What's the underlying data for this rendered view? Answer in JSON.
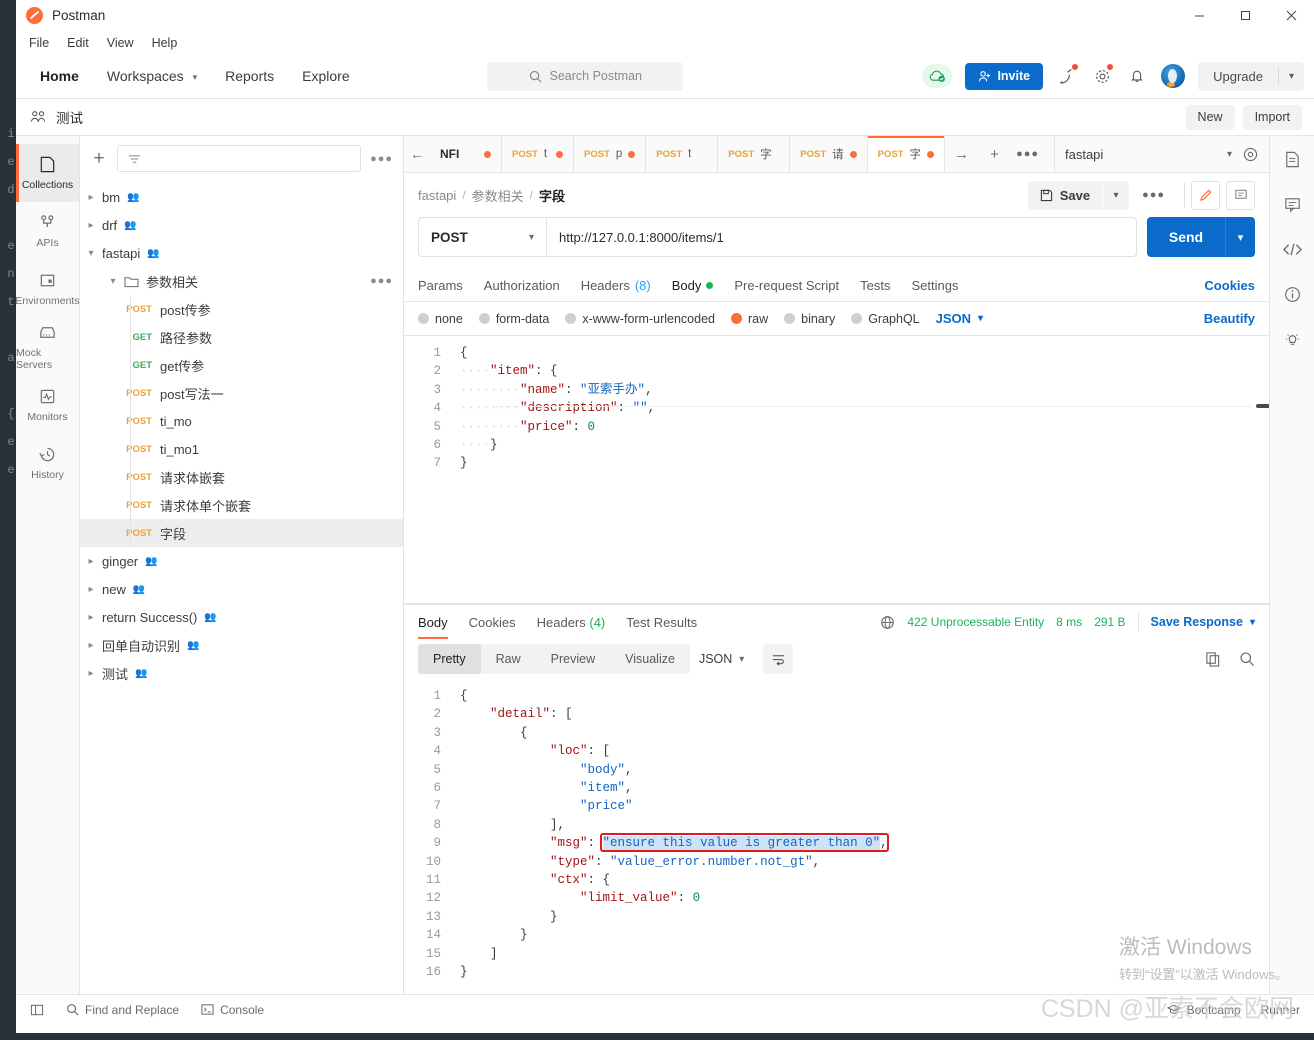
{
  "window": {
    "title": "Postman",
    "minimize": "─",
    "maximize": "☐",
    "close": "✕"
  },
  "menubar": {
    "items": [
      "File",
      "Edit",
      "View",
      "Help"
    ]
  },
  "header": {
    "nav": [
      "Home",
      "Workspaces",
      "Reports",
      "Explore"
    ],
    "search_placeholder": "Search Postman",
    "invite_label": "Invite",
    "upgrade_label": "Upgrade",
    "accent": "#ff6c37",
    "primary_blue": "#0b6bcb"
  },
  "workspace": {
    "name": "测试",
    "new_label": "New",
    "import_label": "Import"
  },
  "rail": {
    "items": [
      {
        "label": "Collections",
        "icon": "collections-icon",
        "active": true
      },
      {
        "label": "APIs",
        "icon": "apis-icon",
        "active": false
      },
      {
        "label": "Environments",
        "icon": "environments-icon",
        "active": false
      },
      {
        "label": "Mock Servers",
        "icon": "mock-servers-icon",
        "active": false
      },
      {
        "label": "Monitors",
        "icon": "monitors-icon",
        "active": false
      },
      {
        "label": "History",
        "icon": "history-icon",
        "active": false
      }
    ]
  },
  "sidebar": {
    "filter_placeholder": "",
    "tree": [
      {
        "type": "collection",
        "label": "bm",
        "expanded": false,
        "shared": true
      },
      {
        "type": "collection",
        "label": "drf",
        "expanded": false,
        "shared": true
      },
      {
        "type": "collection",
        "label": "fastapi",
        "expanded": true,
        "shared": true
      },
      {
        "type": "folder",
        "label": "参数相关",
        "expanded": true,
        "depth": 1
      },
      {
        "type": "request",
        "method": "POST",
        "label": "post传参",
        "depth": 2
      },
      {
        "type": "request",
        "method": "GET",
        "label": "路径参数",
        "depth": 2
      },
      {
        "type": "request",
        "method": "GET",
        "label": "get传参",
        "depth": 2
      },
      {
        "type": "request",
        "method": "POST",
        "label": "post写法一",
        "depth": 2
      },
      {
        "type": "request",
        "method": "POST",
        "label": "ti_mo",
        "depth": 2
      },
      {
        "type": "request",
        "method": "POST",
        "label": "ti_mo1",
        "depth": 2
      },
      {
        "type": "request",
        "method": "POST",
        "label": "请求体嵌套",
        "depth": 2
      },
      {
        "type": "request",
        "method": "POST",
        "label": "请求体单个嵌套",
        "depth": 2
      },
      {
        "type": "request",
        "method": "POST",
        "label": "字段",
        "depth": 2,
        "selected": true
      },
      {
        "type": "collection",
        "label": "ginger",
        "expanded": false,
        "shared": true
      },
      {
        "type": "collection",
        "label": "new",
        "expanded": false,
        "shared": true
      },
      {
        "type": "collection",
        "label": "return Success()",
        "expanded": false,
        "shared": true
      },
      {
        "type": "collection",
        "label": "回单自动识别",
        "expanded": false,
        "shared": true
      },
      {
        "type": "collection",
        "label": "测试",
        "expanded": false,
        "shared": true
      }
    ]
  },
  "tabs": {
    "back_label": "NFI",
    "items": [
      {
        "method": "POST",
        "name": "t",
        "dirty": true,
        "active": false
      },
      {
        "method": "POST",
        "name": "p",
        "dirty": true,
        "active": false
      },
      {
        "method": "POST",
        "name": "t",
        "dirty": false,
        "active": false
      },
      {
        "method": "POST",
        "name": "字",
        "dirty": false,
        "active": false
      },
      {
        "method": "POST",
        "name": "请",
        "dirty": true,
        "active": false
      },
      {
        "method": "POST",
        "name": "字",
        "dirty": true,
        "active": true
      }
    ],
    "environment": "fastapi"
  },
  "request": {
    "breadcrumb": [
      "fastapi",
      "参数相关",
      "字段"
    ],
    "save_label": "Save",
    "method": "POST",
    "url": "http://127.0.0.1:8000/items/1",
    "send_label": "Send",
    "tabs": [
      {
        "label": "Params",
        "active": false
      },
      {
        "label": "Authorization",
        "active": false
      },
      {
        "label": "Headers",
        "count": "(8)",
        "active": false
      },
      {
        "label": "Body",
        "dot": true,
        "active": true
      },
      {
        "label": "Pre-request Script",
        "active": false
      },
      {
        "label": "Tests",
        "active": false
      },
      {
        "label": "Settings",
        "active": false
      }
    ],
    "cookies_label": "Cookies",
    "body_types": [
      {
        "label": "none",
        "selected": false
      },
      {
        "label": "form-data",
        "selected": false
      },
      {
        "label": "x-www-form-urlencoded",
        "selected": false
      },
      {
        "label": "raw",
        "selected": true
      },
      {
        "label": "binary",
        "selected": false
      },
      {
        "label": "GraphQL",
        "selected": false
      }
    ],
    "raw_format": "JSON",
    "beautify_label": "Beautify",
    "body_lines": [
      {
        "n": 1,
        "tokens": [
          {
            "t": "{",
            "c": "p"
          }
        ]
      },
      {
        "n": 2,
        "tokens": [
          {
            "t": "····",
            "c": "ind"
          },
          {
            "t": "\"item\"",
            "c": "k"
          },
          {
            "t": ": ",
            "c": "p"
          },
          {
            "t": "{",
            "c": "p"
          }
        ]
      },
      {
        "n": 3,
        "tokens": [
          {
            "t": "········",
            "c": "ind"
          },
          {
            "t": "\"name\"",
            "c": "k"
          },
          {
            "t": ": ",
            "c": "p"
          },
          {
            "t": "\"亚索手办\"",
            "c": "s"
          },
          {
            "t": ",",
            "c": "p"
          }
        ]
      },
      {
        "n": 4,
        "tokens": [
          {
            "t": "········",
            "c": "ind"
          },
          {
            "t": "\"description\"",
            "c": "k"
          },
          {
            "t": ": ",
            "c": "p"
          },
          {
            "t": "\"\"",
            "c": "s"
          },
          {
            "t": ",",
            "c": "p"
          }
        ]
      },
      {
        "n": 5,
        "tokens": [
          {
            "t": "········",
            "c": "ind"
          },
          {
            "t": "\"price\"",
            "c": "k"
          },
          {
            "t": ": ",
            "c": "p"
          },
          {
            "t": "0",
            "c": "n"
          }
        ]
      },
      {
        "n": 6,
        "tokens": [
          {
            "t": "····",
            "c": "ind"
          },
          {
            "t": "}",
            "c": "p"
          }
        ]
      },
      {
        "n": 7,
        "tokens": [
          {
            "t": "}",
            "c": "p"
          }
        ]
      }
    ]
  },
  "response": {
    "tabs": [
      {
        "label": "Body",
        "active": true
      },
      {
        "label": "Cookies",
        "active": false
      },
      {
        "label": "Headers",
        "count": "(4)",
        "active": false
      },
      {
        "label": "Test Results",
        "active": false
      }
    ],
    "status": "422 Unprocessable Entity",
    "time": "8 ms",
    "size": "291 B",
    "save_response_label": "Save Response",
    "view_modes": [
      {
        "label": "Pretty",
        "active": true
      },
      {
        "label": "Raw",
        "active": false
      },
      {
        "label": "Preview",
        "active": false
      },
      {
        "label": "Visualize",
        "active": false
      }
    ],
    "format": "JSON",
    "body_lines": [
      {
        "n": 1,
        "tokens": [
          {
            "t": "{",
            "c": "p"
          }
        ]
      },
      {
        "n": 2,
        "tokens": [
          {
            "t": "    ",
            "c": "ind"
          },
          {
            "t": "\"detail\"",
            "c": "k"
          },
          {
            "t": ": [",
            "c": "p"
          }
        ]
      },
      {
        "n": 3,
        "tokens": [
          {
            "t": "        ",
            "c": "ind"
          },
          {
            "t": "{",
            "c": "p"
          }
        ]
      },
      {
        "n": 4,
        "tokens": [
          {
            "t": "            ",
            "c": "ind"
          },
          {
            "t": "\"loc\"",
            "c": "k"
          },
          {
            "t": ": [",
            "c": "p"
          }
        ]
      },
      {
        "n": 5,
        "tokens": [
          {
            "t": "                ",
            "c": "ind"
          },
          {
            "t": "\"body\"",
            "c": "s"
          },
          {
            "t": ",",
            "c": "p"
          }
        ]
      },
      {
        "n": 6,
        "tokens": [
          {
            "t": "                ",
            "c": "ind"
          },
          {
            "t": "\"item\"",
            "c": "s"
          },
          {
            "t": ",",
            "c": "p"
          }
        ]
      },
      {
        "n": 7,
        "tokens": [
          {
            "t": "                ",
            "c": "ind"
          },
          {
            "t": "\"price\"",
            "c": "s"
          }
        ]
      },
      {
        "n": 8,
        "tokens": [
          {
            "t": "            ",
            "c": "ind"
          },
          {
            "t": "],",
            "c": "p"
          }
        ]
      },
      {
        "n": 9,
        "tokens": [
          {
            "t": "            ",
            "c": "ind"
          },
          {
            "t": "\"msg\"",
            "c": "k"
          },
          {
            "t": ": ",
            "c": "p"
          },
          {
            "t": "\"ensure this value is greater than 0\"",
            "c": "s"
          },
          {
            "t": ",",
            "c": "p"
          }
        ]
      },
      {
        "n": 10,
        "tokens": [
          {
            "t": "            ",
            "c": "ind"
          },
          {
            "t": "\"type\"",
            "c": "k"
          },
          {
            "t": ": ",
            "c": "p"
          },
          {
            "t": "\"value_error.number.not_gt\"",
            "c": "s"
          },
          {
            "t": ",",
            "c": "p"
          }
        ]
      },
      {
        "n": 11,
        "tokens": [
          {
            "t": "            ",
            "c": "ind"
          },
          {
            "t": "\"ctx\"",
            "c": "k"
          },
          {
            "t": ": {",
            "c": "p"
          }
        ]
      },
      {
        "n": 12,
        "tokens": [
          {
            "t": "                ",
            "c": "ind"
          },
          {
            "t": "\"limit_value\"",
            "c": "k"
          },
          {
            "t": ": ",
            "c": "p"
          },
          {
            "t": "0",
            "c": "n"
          }
        ]
      },
      {
        "n": 13,
        "tokens": [
          {
            "t": "            ",
            "c": "ind"
          },
          {
            "t": "}",
            "c": "p"
          }
        ]
      },
      {
        "n": 14,
        "tokens": [
          {
            "t": "        ",
            "c": "ind"
          },
          {
            "t": "}",
            "c": "p"
          }
        ]
      },
      {
        "n": 15,
        "tokens": [
          {
            "t": "    ",
            "c": "ind"
          },
          {
            "t": "]",
            "c": "p"
          }
        ]
      },
      {
        "n": 16,
        "tokens": [
          {
            "t": "}",
            "c": "p"
          }
        ]
      }
    ],
    "highlight_note": "ensure this value is greater than 0"
  },
  "footer": {
    "find_replace": "Find and Replace",
    "console": "Console",
    "bootcamp": "Bootcamp",
    "runner": "Runner"
  },
  "watermark": {
    "windows_l1": "激活 Windows",
    "windows_l2": "转到“设置”以激活 Windows。",
    "csdn": "CSDN @亚索不会欧网"
  }
}
